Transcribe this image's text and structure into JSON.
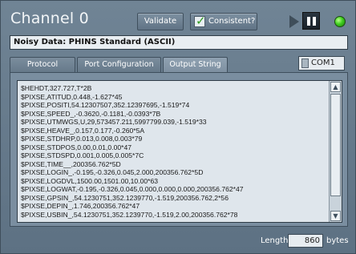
{
  "header": {
    "title": "Channel 0",
    "validate_label": "Validate",
    "consistent_label": "Consistent?",
    "consistent_checked": true,
    "status_led_color": "#3fcf1f"
  },
  "data_name": "Noisy Data: PHINS Standard (ASCII)",
  "tabs": [
    {
      "label": "Protocol Selector",
      "active": false
    },
    {
      "label": "Port Configuration",
      "active": false
    },
    {
      "label": "Output String",
      "active": true
    }
  ],
  "com_port": "COM1",
  "output_lines": [
    "$HEHDT,327.727,T*2B",
    "$PIXSE,ATITUD,0.448,-1.627*45",
    "$PIXSE,POSITI,54.12307507,352.12397695,-1.519*74",
    "$PIXSE,SPEED_,-0.3620,-0.1181,-0.0393*7B",
    "$PIXSE,UTMWGS,U,29,573457.211,5997799.039,-1.519*33",
    "$PIXSE,HEAVE_,0.157,0.177,-0.260*5A",
    "$PIXSE,STDHRP,0.013,0.008,0.003*79",
    "$PIXSE,STDPOS,0.00,0.01,0.00*47",
    "$PIXSE,STDSPD,0.001,0.005,0.005*7C",
    "$PIXSE,TIME__,200356.762*5D",
    "$PIXSE,LOGIN_,-0.195,-0.326,0.045,2.000,200356.762*5D",
    "$PIXSE,LOGDVL,1500.00,1501.00,10.00*63",
    "$PIXSE,LOGWAT,-0.195,-0.326,0.045,0.000,0.000,0.000,200356.762*47",
    "$PIXSE,GPSIN_,54.1230751,352.1239770,-1.519,200356.762,2*56",
    "$PIXSE,DEPIN_,1.746,200356.762*47",
    "$PIXSE,USBIN_,54.1230751,352.1239770,-1.519,2.00,200356.762*78"
  ],
  "length_label": "Length",
  "length_value": "860",
  "length_unit": "bytes"
}
